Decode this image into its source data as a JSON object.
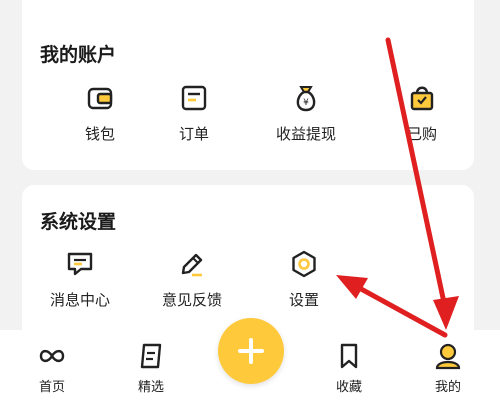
{
  "account": {
    "title": "我的账户",
    "items": [
      {
        "label": "钱包",
        "icon": "wallet-icon"
      },
      {
        "label": "订单",
        "icon": "order-icon"
      },
      {
        "label": "收益提现",
        "icon": "money-bag-icon"
      },
      {
        "label": "已购",
        "icon": "shopping-bag-icon"
      }
    ]
  },
  "system": {
    "title": "系统设置",
    "items": [
      {
        "label": "消息中心",
        "icon": "message-icon"
      },
      {
        "label": "意见反馈",
        "icon": "pencil-icon"
      },
      {
        "label": "设置",
        "icon": "settings-icon"
      }
    ]
  },
  "tabbar": {
    "tabs": [
      {
        "label": "首页",
        "icon": "infinity-icon"
      },
      {
        "label": "精选",
        "icon": "featured-icon"
      },
      {
        "label": "收藏",
        "icon": "bookmark-icon"
      },
      {
        "label": "我的",
        "icon": "user-icon",
        "active": true
      }
    ],
    "center_button_icon": "plus-icon"
  },
  "colors": {
    "accent": "#ffc93c",
    "annotation_arrow": "#e02020",
    "icon_stroke": "#222222"
  }
}
